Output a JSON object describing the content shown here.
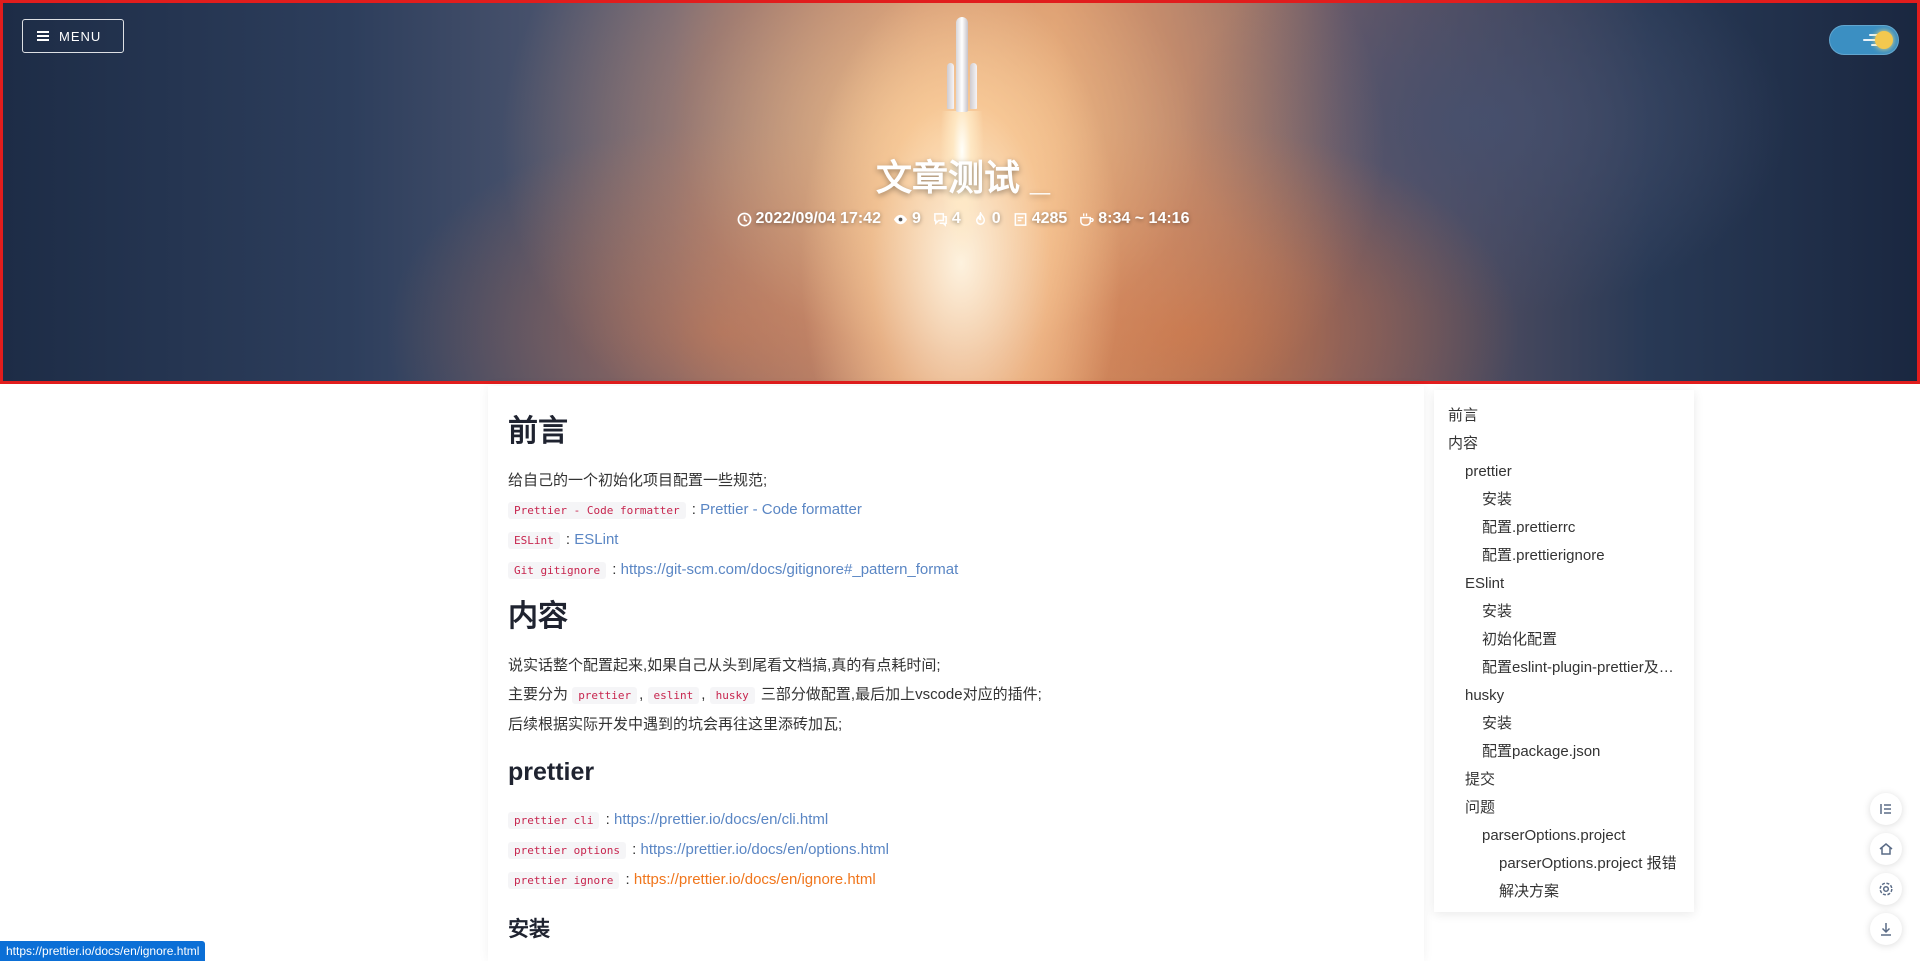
{
  "header": {
    "menu_label": "MENU",
    "title": "文章测试 _",
    "meta": {
      "date": "2022/09/04 17:42",
      "views": "9",
      "comments": "4",
      "likes": "0",
      "words": "4285",
      "read_time": "8:34 ~ 14:16"
    }
  },
  "article": {
    "h_preface": "前言",
    "preface_intro": "给自己的一个初始化项目配置一些规范;",
    "preface_links": [
      {
        "code": "Prettier - Code formatter",
        "sep": " : ",
        "link": "Prettier - Code formatter"
      },
      {
        "code": "ESLint",
        "sep": " : ",
        "link": "ESLint"
      },
      {
        "code": "Git gitignore",
        "sep": " : ",
        "link": "https://git-scm.com/docs/gitignore#_pattern_format"
      }
    ],
    "h_content": "内容",
    "content_p1": "说实话整个配置起来,如果自己从头到尾看文档搞,真的有点耗时间;",
    "content_p2_pre": "主要分为",
    "content_p2_code1": "prettier",
    "content_p2_sep1": ",",
    "content_p2_code2": "eslint",
    "content_p2_sep2": ",",
    "content_p2_code3": "husky",
    "content_p2_post": "三部分做配置,最后加上vscode对应的插件;",
    "content_p3": "后续根据实际开发中遇到的坑会再往这里添砖加瓦;",
    "h_prettier": "prettier",
    "prettier_links": [
      {
        "code": "prettier cli",
        "sep": " : ",
        "link": "https://prettier.io/docs/en/cli.html"
      },
      {
        "code": "prettier options",
        "sep": " : ",
        "link": "https://prettier.io/docs/en/options.html"
      },
      {
        "code": "prettier ignore",
        "sep": " : ",
        "link": "https://prettier.io/docs/en/ignore.html"
      }
    ],
    "h_install": "安装"
  },
  "toc": [
    {
      "label": "前言",
      "level": 0
    },
    {
      "label": "内容",
      "level": 0
    },
    {
      "label": "prettier",
      "level": 1
    },
    {
      "label": "安装",
      "level": 2
    },
    {
      "label": "配置.prettierrc",
      "level": 2
    },
    {
      "label": "配置.prettierignore",
      "level": 2
    },
    {
      "label": "ESlint",
      "level": 1
    },
    {
      "label": "安装",
      "level": 2
    },
    {
      "label": "初始化配置",
      "level": 2
    },
    {
      "label": "配置eslint-plugin-prettier及eslint-config-prettier",
      "level": 2
    },
    {
      "label": "husky",
      "level": 1
    },
    {
      "label": "安装",
      "level": 2
    },
    {
      "label": "配置package.json",
      "level": 2
    },
    {
      "label": "提交",
      "level": 1
    },
    {
      "label": "问题",
      "level": 1
    },
    {
      "label": "parserOptions.project",
      "level": 2
    },
    {
      "label": "parserOptions.project 报错",
      "level": 3
    },
    {
      "label": "解决方案",
      "level": 3
    }
  ],
  "fabs": [
    "toc-icon",
    "home-icon",
    "settings-icon",
    "download-icon"
  ],
  "status_url": "https://prettier.io/docs/en/ignore.html",
  "colors": {
    "link": "#5a86c4",
    "link_hover": "#f0761c",
    "code": "#c7254e",
    "hero_border": "#e11d1d",
    "status_bg": "#0b6fd6"
  }
}
